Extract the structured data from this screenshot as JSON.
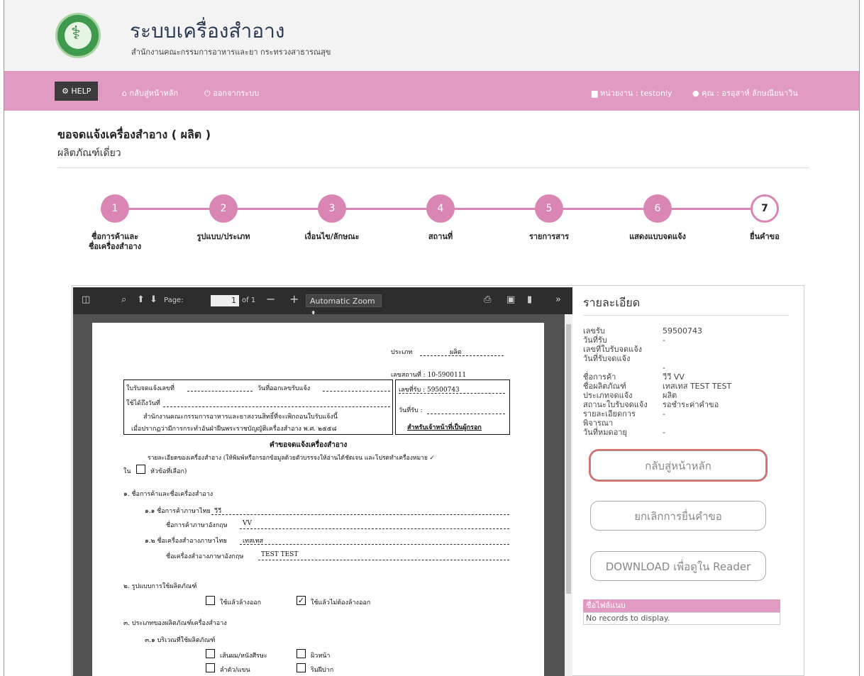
{
  "header": {
    "title": "ระบบเครื่องสำอาง",
    "subtitle": "สำนักงานคณะกรรมการอาหารและยา กระทรวงสาธารณสุข"
  },
  "nav": {
    "help": "HELP",
    "home": "กลับสู่หน้าหลัก",
    "logout": "ออกจากระบบ",
    "agency": "หน่วยงาน : testonly",
    "user": "คุณ : อรอุสาห์ ลักษณียนาวิน"
  },
  "page": {
    "title": "ขอจดแจ้งเครื่องสำอาง ( ผลิต )",
    "subtitle": "ผลิตภัณฑ์เดี่ยว"
  },
  "steps": [
    {
      "num": "1",
      "label": "ชื่อการค้าและ\nชื่อเครื่องสำอาง"
    },
    {
      "num": "2",
      "label": "รูปแบบ/ประเภท"
    },
    {
      "num": "3",
      "label": "เงื่อนไข/ลักษณะ"
    },
    {
      "num": "4",
      "label": "สถานที่"
    },
    {
      "num": "5",
      "label": "รายการสาร"
    },
    {
      "num": "6",
      "label": "แสดงแบบจดแจ้ง"
    },
    {
      "num": "7",
      "label": "ยื่นคำขอ"
    }
  ],
  "viewer": {
    "page_label": "Page:",
    "page_value": "1",
    "page_of": "of 1",
    "zoom": "Automatic Zoom"
  },
  "doc": {
    "type_label": "ประเภท",
    "type_value": "ผลิต",
    "place_no": "เลขสถานที่ : 10-5900111",
    "receipt_no_label": "ใบรับจดแจ้งเลขที่",
    "issue_date_label": "วันที่ออกเลขรับแจ้ง",
    "valid_until": "ใช้ได้ถึงวันที่",
    "line1": "สำนักงานคณะกรรมการอาหารและยาสงวนสิทธิ์ที่จะเพิกถอนใบรับแจ้งนี้",
    "line2": "เมื่อปรากฏว่ามีการกระทำอันฝ่าฝืนพระราชบัญญัติเครื่องสำอาง พ.ศ. ๒๕๕๘",
    "rcv_no": "เลขที่รับ : 59500743",
    "rcv_date": "วันที่รับ :",
    "officer": "สำหรับเจ้าหน้าที่เป็นผู้กรอก",
    "form_title": "คำขอจดแจ้งเครื่องสำอาง",
    "instruction": "รายละเอียดของเครื่องสำอาง (ให้พิมพ์หรือกรอกข้อมูลด้วยตัวบรรจงให้อ่านได้ชัดเจน และโปรดทำเครื่องหมาย ✓",
    "instruction2": "หัวข้อที่เลือก)",
    "instruction2_prefix": "ใน",
    "s1": "๑. ชื่อการค้าและชื่อเครื่องสำอาง",
    "s1_1": "๑.๑ ชื่อการค้าภาษาไทย",
    "s1_1_val": "วีวี",
    "s1_1en": "ชื่อการค้าภาษาอังกฤษ",
    "s1_1en_val": "VV",
    "s1_2": "๑.๒ ชื่อเครื่องสำอางภาษาไทย",
    "s1_2_val": "เทสเทส",
    "s1_2en": "ชื่อเครื่องสำอางภาษาอังกฤษ",
    "s1_2en_val": "TEST TEST",
    "s2": "๒. รูปแบบการใช้ผลิตภัณฑ์",
    "s2_opt1": "ใช้แล้วล้างออก",
    "s2_opt2": "ใช้แล้วไม่ต้องล้างออก",
    "s3": "๓. ประเภทของผลิตภัณฑ์เครื่องสำอาง",
    "s3_1": "๓.๑ บริเวณที่ใช้ผลิตภัณฑ์",
    "s3_opt1": "เส้นผม/หนังศีรษะ",
    "s3_opt2": "ผิวหน้า",
    "s3_opt3": "ลำตัว/แขน",
    "s3_opt4": "ริมฝีปาก"
  },
  "detail": {
    "title": "รายละเอียด",
    "rows": [
      {
        "label": "เลขรับ",
        "value": "59500743"
      },
      {
        "label": "วันที่รับ",
        "value": "-"
      },
      {
        "label": "เลขที่ใบรับจดแจ้ง",
        "value": ""
      },
      {
        "label": "วันที่รับจดแจ้ง",
        "value": "-"
      },
      {
        "label": "ชื่อการค้า",
        "value": "วีวี VV"
      },
      {
        "label": "ชื่อผลิตภัณฑ์",
        "value": "เทสเทส TEST TEST"
      },
      {
        "label": "ประเภทจดแจ้ง",
        "value": "ผลิต"
      },
      {
        "label": "สถานะใบรับจดแจ้ง",
        "value": "รอชำระค่าคำขอ"
      },
      {
        "label": "รายละเอียดการ",
        "value": "-"
      },
      {
        "label": "พิจารณา",
        "value": ""
      },
      {
        "label": "วันที่หมดอายุ",
        "value": "-"
      }
    ],
    "btn_home": "กลับสู่หน้าหลัก",
    "btn_cancel": "ยกเลิกการยื่นคำขอ",
    "btn_download": "DOWNLOAD เพื่อดูใน Reader",
    "attach_header": "ชื่อไฟล์แนบ",
    "attach_empty": "No records to display."
  },
  "colors": {
    "nav_pink": "#e19ac1",
    "step_pink": "#d986b4"
  }
}
